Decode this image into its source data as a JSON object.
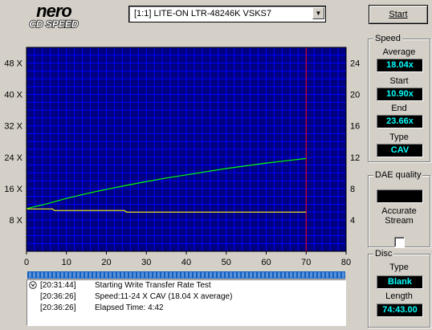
{
  "app": {
    "logo_top": "nero",
    "logo_bottom": "CD SPEED"
  },
  "drive": {
    "selected": "[1:1]  LITE-ON LTR-48246K VSKS7"
  },
  "toolbar": {
    "start_label": "Start"
  },
  "speed": {
    "title": "Speed",
    "average_label": "Average",
    "average_value": "18.04x",
    "start_label": "Start",
    "start_value": "10.90x",
    "end_label": "End",
    "end_value": "23.66x",
    "type_label": "Type",
    "type_value": "CAV"
  },
  "dae": {
    "title": "DAE quality",
    "accurate_label": "Accurate",
    "stream_label": "Stream",
    "stream_checked": false
  },
  "disc": {
    "title": "Disc",
    "type_label": "Type",
    "type_value": "Blank",
    "length_label": "Length",
    "length_value": "74:43.00"
  },
  "log": {
    "entries": [
      {
        "time": "[20:31:44]",
        "message": "Starting Write Transfer Rate Test"
      },
      {
        "time": "[20:36:26]",
        "message": "Speed:11-24 X CAV (18.04 X average)"
      },
      {
        "time": "[20:36:26]",
        "message": "Elapsed Time:  4:42"
      }
    ]
  },
  "chart_data": {
    "type": "line",
    "x_ticks": [
      0,
      10,
      20,
      30,
      40,
      50,
      60,
      70,
      80
    ],
    "y_left_ticks": [
      "8 X",
      "16 X",
      "24 X",
      "32 X",
      "40 X",
      "48 X"
    ],
    "y_right_ticks": [
      4,
      8,
      12,
      16,
      20,
      24
    ],
    "xlim": [
      0,
      80
    ],
    "ylim_left": [
      0,
      52
    ],
    "ylim_right": [
      0,
      26
    ],
    "end_marker_x": 70,
    "grid": true,
    "colors": {
      "background": "#000080",
      "grid": "#0000ff",
      "speed_line": "#00ff00",
      "cpu_line": "#ffff00",
      "end_marker": "#ff0000"
    },
    "series": [
      {
        "axis": "left",
        "x": [
          0,
          5,
          10,
          15,
          20,
          25,
          30,
          35,
          40,
          45,
          50,
          55,
          60,
          65,
          70
        ],
        "y": [
          10.9,
          12.1,
          13.5,
          14.7,
          15.8,
          16.8,
          17.8,
          18.7,
          19.5,
          20.3,
          21.1,
          21.8,
          22.5,
          23.1,
          23.66
        ]
      },
      {
        "axis": "right",
        "x": [
          0,
          6.5,
          7,
          24.5,
          25,
          70
        ],
        "y": [
          5.4,
          5.4,
          5.2,
          5.2,
          5.0,
          5.0
        ]
      }
    ]
  }
}
